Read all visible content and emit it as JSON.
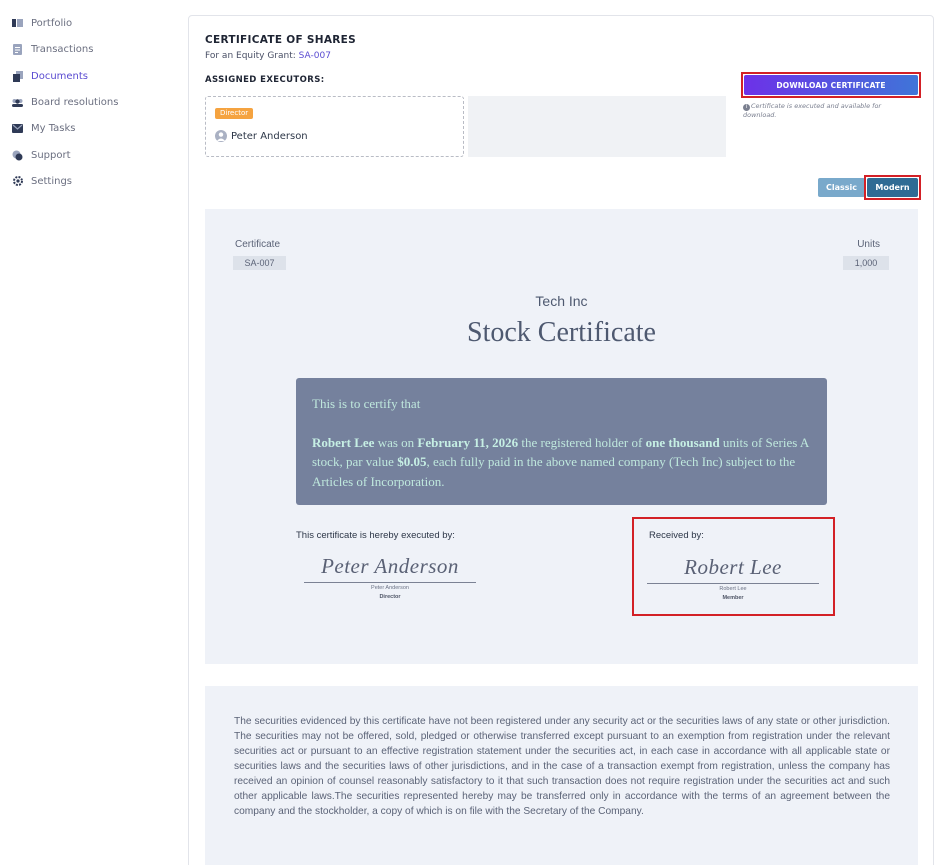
{
  "sidebar": {
    "items": [
      {
        "label": "Portfolio",
        "icon": "portfolio-icon"
      },
      {
        "label": "Transactions",
        "icon": "transactions-icon"
      },
      {
        "label": "Documents",
        "icon": "documents-icon",
        "active": true
      },
      {
        "label": "Board resolutions",
        "icon": "board-resolutions-icon"
      },
      {
        "label": "My Tasks",
        "icon": "tasks-icon"
      },
      {
        "label": "Support",
        "icon": "support-icon"
      },
      {
        "label": "Settings",
        "icon": "settings-icon"
      }
    ]
  },
  "header": {
    "title": "CERTIFICATE OF SHARES",
    "sub_prefix": "For an Equity Grant:",
    "grant_link": "SA-007",
    "executors_heading": "ASSIGNED EXECUTORS:"
  },
  "executor": {
    "role": "Director",
    "name": "Peter Anderson"
  },
  "download": {
    "label": "DOWNLOAD CERTIFICATE",
    "note": "Certificate is executed and available for download."
  },
  "view_toggle": {
    "classic": "Classic",
    "modern": "Modern"
  },
  "certificate": {
    "id_label": "Certificate",
    "id_value": "SA-007",
    "units_label": "Units",
    "units_value": "1,000",
    "company": "Tech Inc",
    "title": "Stock Certificate",
    "intro": "This is to certify that",
    "holder": "Robert Lee",
    "text_1": " was on ",
    "date": "February 11, 2026",
    "text_2": " the registered holder of ",
    "units_words": "one thousand",
    "text_3": " units of Series A stock, par value ",
    "par_value": "$0.05",
    "text_4": ", each fully paid in the above named company (Tech Inc) subject to the Articles of Incorporation."
  },
  "signatures": {
    "executed_caption": "This certificate is hereby executed by:",
    "executor_signature": "Peter Anderson",
    "executor_name": "Peter Anderson",
    "executor_role": "Director",
    "received_caption": "Received by:",
    "receiver_signature": "Robert Lee",
    "receiver_name": "Robert Lee",
    "receiver_role": "Member"
  },
  "legend": {
    "text": "The securities evidenced by this certificate have not been registered under any security act or the securities laws of any state or other jurisdiction. The securities may not be offered, sold, pledged or otherwise transferred except pursuant to an exemption from registration under the relevant securities act or pursuant to an effective registration statement under the securities act, in each case in accordance with all applicable state or securities laws and the securities laws of other jurisdictions, and in the case of a transaction exempt from registration, unless the company has received an opinion of counsel reasonably satisfactory to it that such transaction does not require registration under the securities act and such other applicable laws.The securities represented hereby may be transferred only in accordance with the terms of an agreement between the company and the stockholder, a copy of which is on file with the Secretary of the Company."
  },
  "colors": {
    "accent": "#5a4bd1",
    "highlight": "#d32026",
    "certificate_panel": "#75819d",
    "certificate_text": "#bfe8dd"
  }
}
